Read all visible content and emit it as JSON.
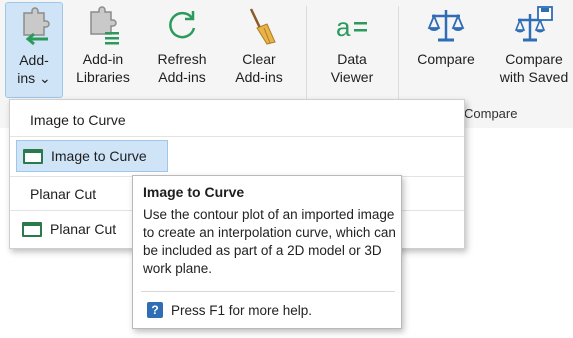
{
  "ribbon": {
    "buttons": [
      {
        "line1": "Add-",
        "line2": "ins ⌄",
        "icon": "puzzle-arrow-icon"
      },
      {
        "line1": "Add-in",
        "line2": "Libraries",
        "icon": "puzzle-list-icon"
      },
      {
        "line1": "Refresh",
        "line2": "Add-ins",
        "icon": "refresh-icon"
      },
      {
        "line1": "Clear",
        "line2": "Add-ins",
        "icon": "broom-icon"
      },
      {
        "line1": "Data",
        "line2": "Viewer",
        "icon": "data-viewer-icon"
      },
      {
        "line1": "Compare",
        "line2": "",
        "icon": "scales-icon"
      },
      {
        "line1": "Compare",
        "line2": "with Saved",
        "icon": "scales-save-icon"
      }
    ],
    "group_label": "Compare"
  },
  "menu": {
    "section1_header": "Image to Curve",
    "item1_label": "Image to Curve",
    "section2_header": "Planar Cut",
    "item2_label": "Planar Cut"
  },
  "tooltip": {
    "title": "Image to Curve",
    "description": "Use the contour plot of an imported image to create an interpolation curve, which can be included as part of a 2D model or 3D work plane.",
    "help_text": "Press F1 for more help.",
    "help_icon_glyph": "?"
  },
  "colors": {
    "accent_green": "#2b9a5b",
    "selection": "#cfe4f7",
    "ribbon_bg": "#f5f5f5"
  }
}
